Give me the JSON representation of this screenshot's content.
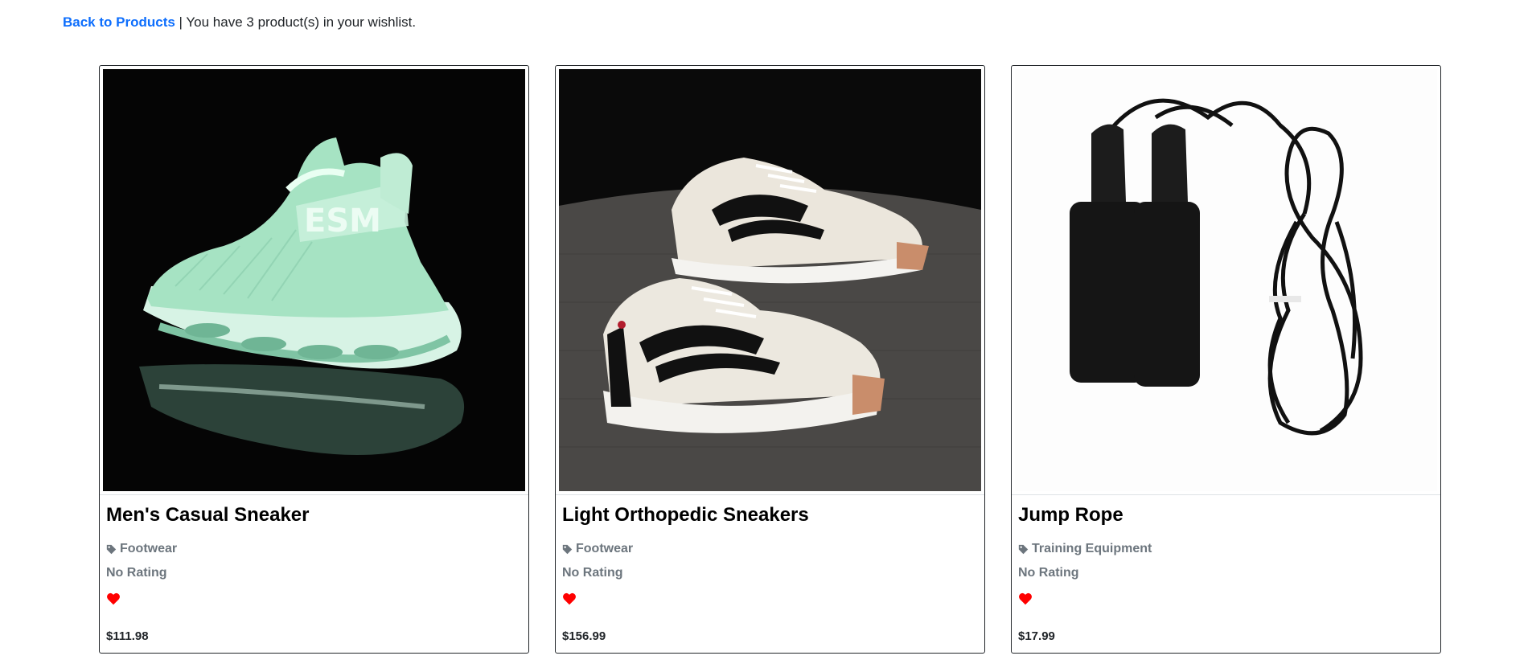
{
  "header": {
    "back_link": "Back to Products",
    "separator": "|",
    "wishlist_text": "You have 3 product(s) in your wishlist."
  },
  "products": [
    {
      "title": "Men's Casual Sneaker",
      "category": "Footwear",
      "rating": "No Rating",
      "price": "$111.98",
      "image": "mint-green-sneaker-photo",
      "icon_tag": "tag-icon",
      "icon_heart": "heart-icon"
    },
    {
      "title": "Light Orthopedic Sneakers",
      "category": "Footwear",
      "rating": "No Rating",
      "price": "$156.99",
      "image": "white-black-sneakers-photo",
      "icon_tag": "tag-icon",
      "icon_heart": "heart-icon"
    },
    {
      "title": "Jump Rope",
      "category": "Training Equipment",
      "rating": "No Rating",
      "price": "$17.99",
      "image": "black-jump-rope-photo",
      "icon_tag": "tag-icon",
      "icon_heart": "heart-icon"
    }
  ],
  "colors": {
    "link": "#0d6efd",
    "muted": "#6c757d",
    "heart": "#ff0000",
    "border": "#212529"
  }
}
